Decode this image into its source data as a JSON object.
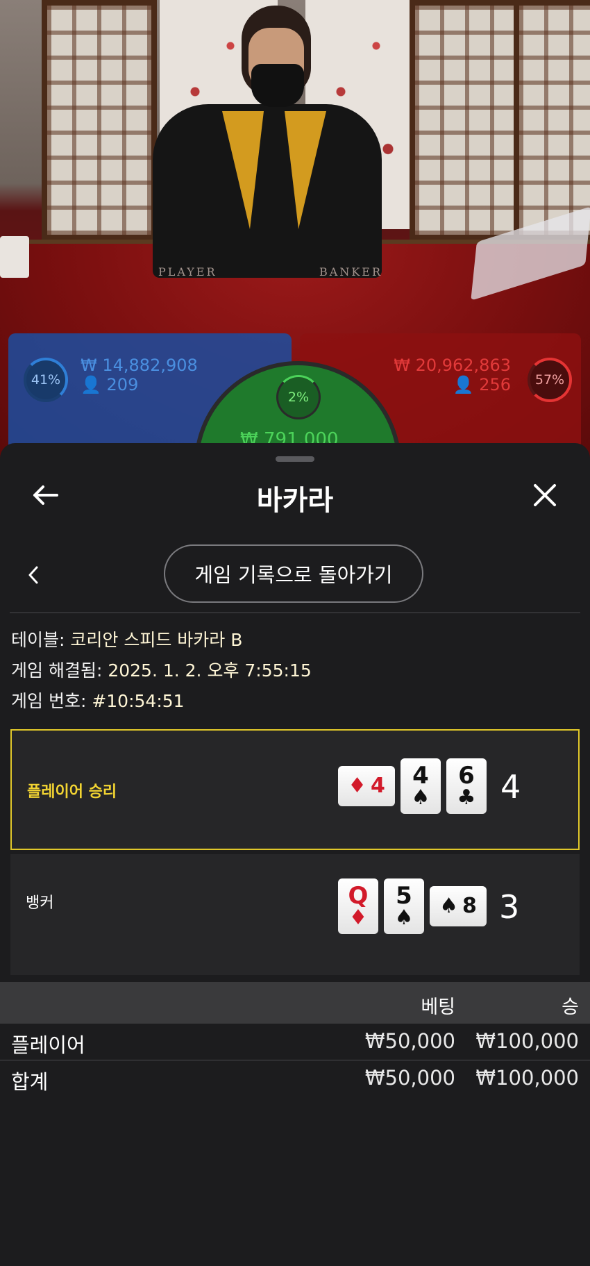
{
  "video": {
    "table_labels": [
      "PLAYER",
      "BANKER"
    ],
    "player": {
      "percent": "41%",
      "amount": "₩ 14,882,908",
      "players": "209"
    },
    "tie": {
      "percent": "2%",
      "amount": "₩ 791,000"
    },
    "banker": {
      "percent": "57%",
      "amount": "₩ 20,962,863",
      "players": "256"
    },
    "colors": {
      "player": "#2f7fd7",
      "banker": "#e23a3a",
      "tie": "#4cd35a"
    }
  },
  "header": {
    "title": "바카라",
    "back_icon": "arrow-left-icon",
    "close_icon": "close-icon"
  },
  "nav": {
    "prev_icon": "chevron-left-icon",
    "back_to_history": "게임 기록으로 돌아가기"
  },
  "info": {
    "table_label": "테이블: ",
    "table_value": "코리안 스피드 바카라 B",
    "resolved_label": "게임 해결됨: ",
    "resolved_value": "2025. 1. 2. 오후 7:55:15",
    "number_label": "게임 번호: ",
    "number_value": "#10:54:51"
  },
  "results": {
    "player": {
      "label": "플레이어 승리",
      "cards": [
        {
          "rank": "4",
          "suit": "♦",
          "color": "red",
          "sideways": true
        },
        {
          "rank": "4",
          "suit": "♠",
          "color": "black",
          "sideways": false
        },
        {
          "rank": "6",
          "suit": "♣",
          "color": "black",
          "sideways": false
        }
      ],
      "score": "4"
    },
    "banker": {
      "label": "뱅커",
      "cards": [
        {
          "rank": "Q",
          "suit": "♦",
          "color": "red",
          "sideways": false
        },
        {
          "rank": "5",
          "suit": "♠",
          "color": "black",
          "sideways": false
        },
        {
          "rank": "8",
          "suit": "♠",
          "color": "black",
          "sideways": true
        }
      ],
      "score": "3"
    },
    "win_color": "#e0c72a"
  },
  "bets": {
    "columns": [
      "베팅",
      "승"
    ],
    "rows": [
      {
        "name": "플레이어",
        "bet": "₩50,000",
        "win": "₩100,000"
      },
      {
        "name": "합계",
        "bet": "₩50,000",
        "win": "₩100,000"
      }
    ]
  }
}
